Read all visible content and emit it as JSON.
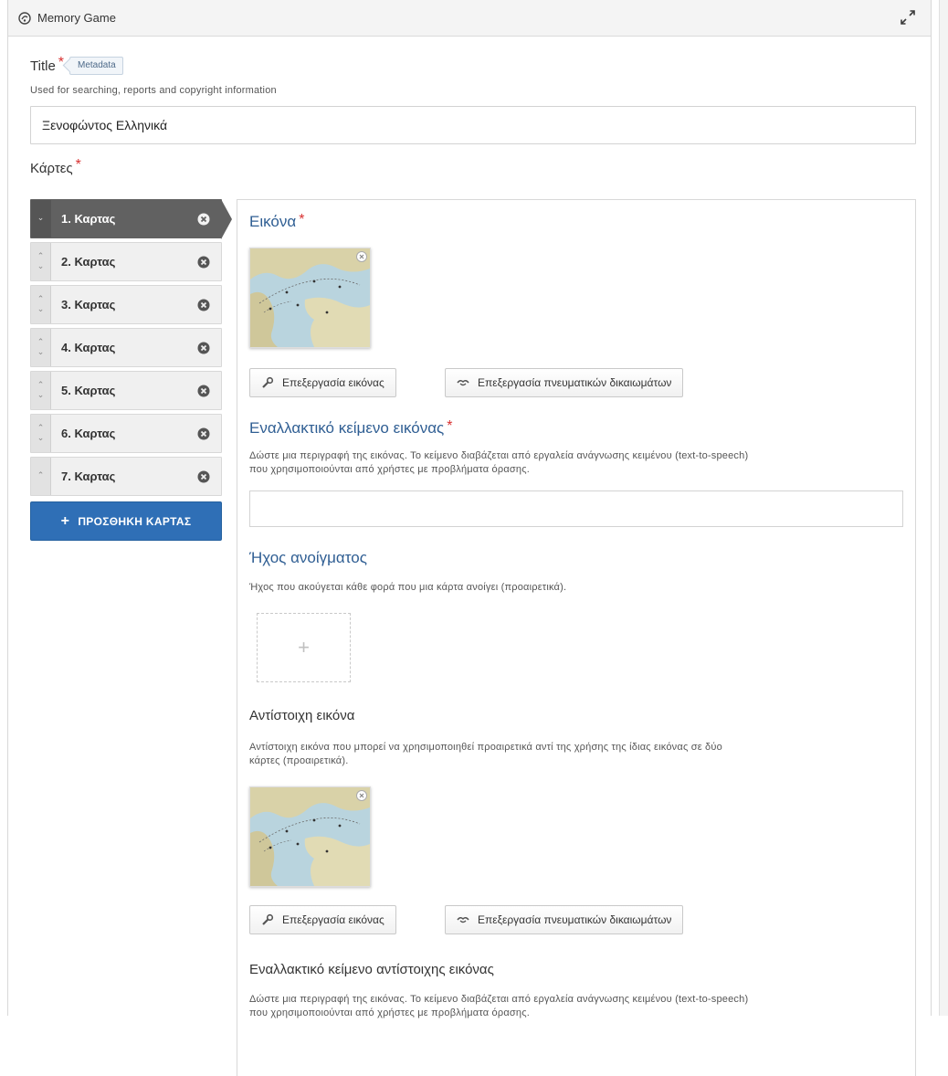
{
  "header": {
    "title": "Memory Game",
    "logo_icon": "h5p-logo-icon",
    "expand_icon": "fullscreen-expand-icon"
  },
  "title_field": {
    "label": "Title",
    "required_mark": "*",
    "metadata_button": "Metadata",
    "description": "Used for searching, reports and copyright information",
    "value": "Ξενοφώντος Ελληνικά"
  },
  "cards": {
    "label": "Κάρτες",
    "required_mark": "*",
    "items": [
      {
        "label": "1. Καρτας",
        "active": true
      },
      {
        "label": "2. Καρτας",
        "active": false
      },
      {
        "label": "3. Καρτας",
        "active": false
      },
      {
        "label": "4. Καρτας",
        "active": false
      },
      {
        "label": "5. Καρτας",
        "active": false
      },
      {
        "label": "6. Καρτας",
        "active": false
      },
      {
        "label": "7. Καρτας",
        "active": false
      }
    ],
    "add_button": "ΠΡΟΣΘΗΚΗ ΚΑΡΤΑΣ"
  },
  "card_editor": {
    "image": {
      "label": "Εικόνα",
      "required_mark": "*",
      "edit_image_button": "Επεξεργασία εικόνας",
      "edit_copyright_button": "Επεξεργασία πνευματικών δικαιωμάτων"
    },
    "alt_text": {
      "label": "Εναλλακτικό κείμενο εικόνας",
      "required_mark": "*",
      "description_line1": "Δώστε μια περιγραφή της εικόνας. Το κείμενο διαβάζεται από εργαλεία ανάγνωσης κειμένου (text-to-speech)",
      "description_line2": "που χρησιμοποιούνται από χρήστες με προβλήματα όρασης.",
      "value": ""
    },
    "audio": {
      "label": "Ήχος ανοίγματος",
      "description": "Ήχος που ακούγεται κάθε φορά που μια κάρτα ανοίγει (προαιρετικά).",
      "add_symbol": "+"
    },
    "matching_image": {
      "label": "Αντίστοιχη εικόνα",
      "description_line1": "Αντίστοιχη εικόνα που μπορεί να χρησιμοποιηθεί προαιρετικά αντί της χρήσης της ίδιας εικόνας σε δύο",
      "description_line2": "κάρτες (προαιρετικά).",
      "edit_image_button": "Επεξεργασία εικόνας",
      "edit_copyright_button": "Επεξεργασία πνευματικών δικαιωμάτων"
    },
    "matching_alt_text": {
      "label": "Εναλλακτικό κείμενο αντίστοιχης εικόνας",
      "description_line1": "Δώστε μια περιγραφή της εικόνας. Το κείμενο διαβάζεται από εργαλεία ανάγνωσης κειμένου (text-to-speech)",
      "description_line2": "που χρησιμοποιούνται από χρήστες με προβλήματα όρασης."
    }
  },
  "colors": {
    "accent_blue": "#2f6fb6",
    "heading_blue": "#2f5e93",
    "required_red": "#d83131",
    "active_card": "#616161"
  }
}
